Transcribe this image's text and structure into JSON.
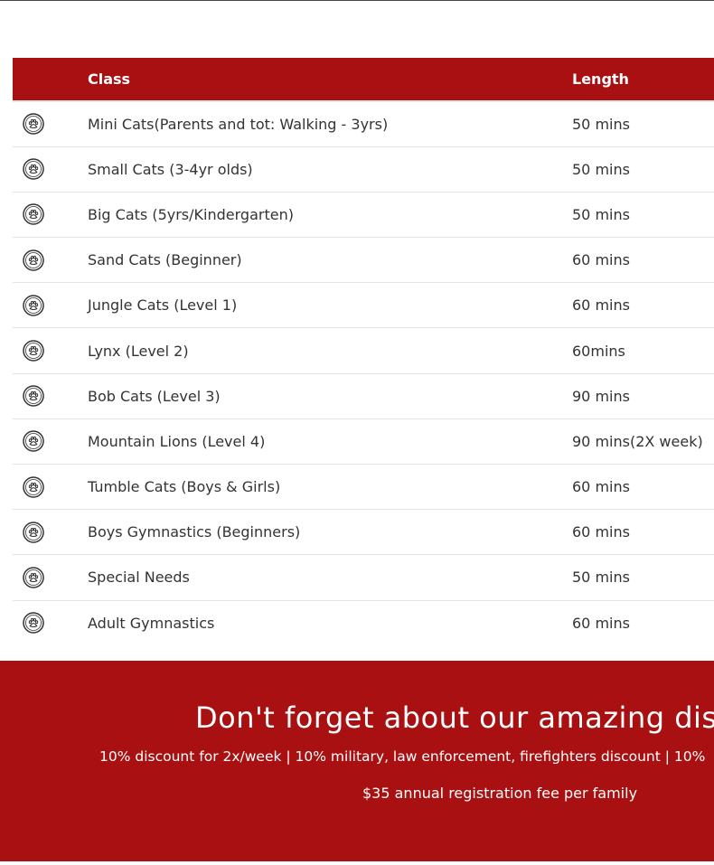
{
  "table": {
    "headers": {
      "icon": "",
      "class": "Class",
      "length": "Length"
    },
    "row_icon": "paw-icon",
    "rows": [
      {
        "class": "Mini Cats(Parents and tot: Walking - 3yrs)",
        "length": "50 mins"
      },
      {
        "class": "Small Cats (3-4yr olds)",
        "length": "50 mins"
      },
      {
        "class": "Big Cats (5yrs/Kindergarten)",
        "length": "50 mins"
      },
      {
        "class": "Sand Cats (Beginner)",
        "length": "60 mins"
      },
      {
        "class": "Jungle Cats (Level 1)",
        "length": "60 mins"
      },
      {
        "class": "Lynx (Level 2)",
        "length": "60mins"
      },
      {
        "class": "Bob Cats (Level 3)",
        "length": "90 mins"
      },
      {
        "class": "Mountain Lions (Level 4)",
        "length": "90 mins(2X week)"
      },
      {
        "class": "Tumble Cats (Boys & Girls)",
        "length": "60 mins"
      },
      {
        "class": "Boys Gymnastics (Beginners)",
        "length": "60 mins"
      },
      {
        "class": "Special Needs",
        "length": "50 mins"
      },
      {
        "class": "Adult Gymnastics",
        "length": "60 mins"
      }
    ]
  },
  "discounts": {
    "title": "Don't forget about our amazing disc",
    "list": "10% discount for 2x/week | 10% military, law enforcement, firefighters discount | 10%",
    "registration_fee": "$35 annual registration fee per family"
  },
  "colors": {
    "brand_red": "#a81011",
    "text": "#333333",
    "row_border": "#e3e3e3"
  }
}
